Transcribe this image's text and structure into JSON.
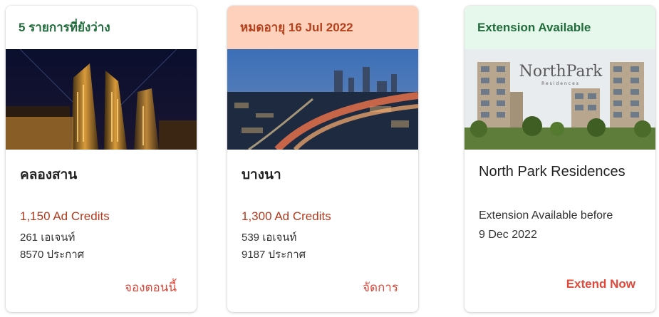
{
  "cards": [
    {
      "header": "5 รายการที่ยังว่าง",
      "image": "city-night-skyline",
      "title": "คลองสาน",
      "credits": "1,150 Ad Credits",
      "agents": "261 เอเจนท์",
      "listings": "8570 ประกาศ",
      "action": "จองตอนนี้"
    },
    {
      "header": "หมดอายุ 16 Jul 2022",
      "image": "city-expressway-dusk",
      "title": "บางนา",
      "credits": "1,300 Ad Credits",
      "agents": "539 เอเจนท์",
      "listings": "9187 ประกาศ",
      "action": "จัดการ"
    },
    {
      "header": "Extension Available",
      "image": "north-park-residences-render",
      "logo_text": "NorthPark",
      "logo_sub": "Residences",
      "title": "North Park Residences",
      "ext_line1": "Extension Available before",
      "ext_line2": "9 Dec 2022",
      "action": "Extend Now"
    }
  ],
  "colors": {
    "header_green": "#1f6b3a",
    "header_expiry_bg": "#fdd1bc",
    "header_expiry_text": "#b5401c",
    "header_ext_bg": "#e6f7ec",
    "credits": "#b23a1e",
    "action": "#e0483a"
  }
}
